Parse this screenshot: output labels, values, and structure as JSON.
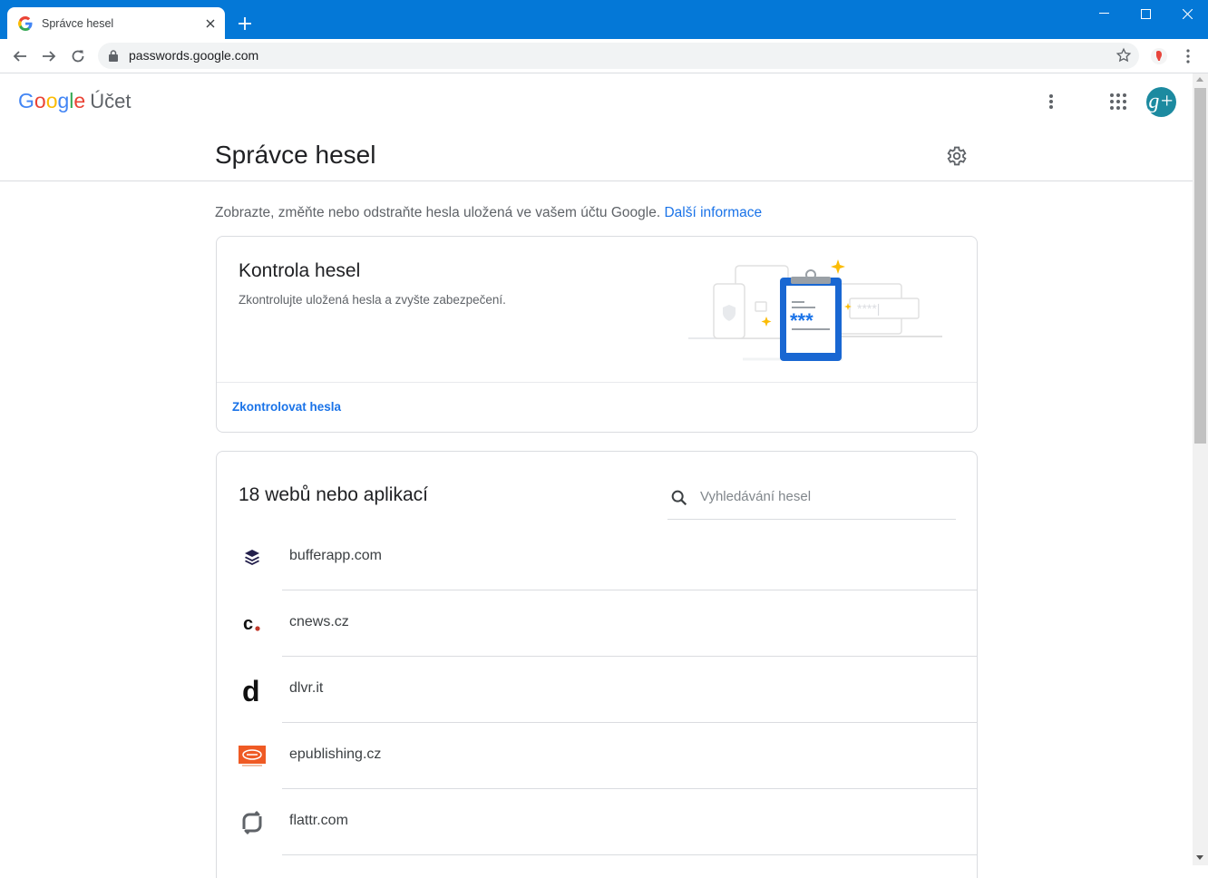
{
  "browser": {
    "tab_title": "Správce hesel",
    "url": "passwords.google.com"
  },
  "header": {
    "logo_letters": [
      "G",
      "o",
      "o",
      "g",
      "l",
      "e"
    ],
    "logo_colors": [
      "#4285f4",
      "#ea4335",
      "#fbbc05",
      "#4285f4",
      "#34a853",
      "#ea4335"
    ],
    "account_label": "Účet",
    "avatar_text": "g+"
  },
  "page": {
    "title": "Správce hesel",
    "intro_text": "Zobrazte, změňte nebo odstraňte hesla uložená ve vašem účtu Google.",
    "intro_link": "Další informace"
  },
  "checkup": {
    "title": "Kontrola hesel",
    "description": "Zkontrolujte uložená hesla a zvyšte zabezpečení.",
    "action": "Zkontrolovat hesla",
    "illustration_password": "***",
    "illustration_masked": "****|"
  },
  "passwords": {
    "count_title": "18 webů nebo aplikací",
    "search_placeholder": "Vyhledávání hesel",
    "items": [
      {
        "name": "bufferapp.com",
        "icon": "buffer-icon"
      },
      {
        "name": "cnews.cz",
        "icon": "cnews-icon"
      },
      {
        "name": "dlvr.it",
        "icon": "dlvr-icon"
      },
      {
        "name": "epublishing.cz",
        "icon": "epublishing-icon"
      },
      {
        "name": "flattr.com",
        "icon": "flattr-icon"
      }
    ]
  },
  "colors": {
    "titlebar": "#0478d7",
    "link": "#1a73e8",
    "avatar": "#1c8aa0"
  }
}
